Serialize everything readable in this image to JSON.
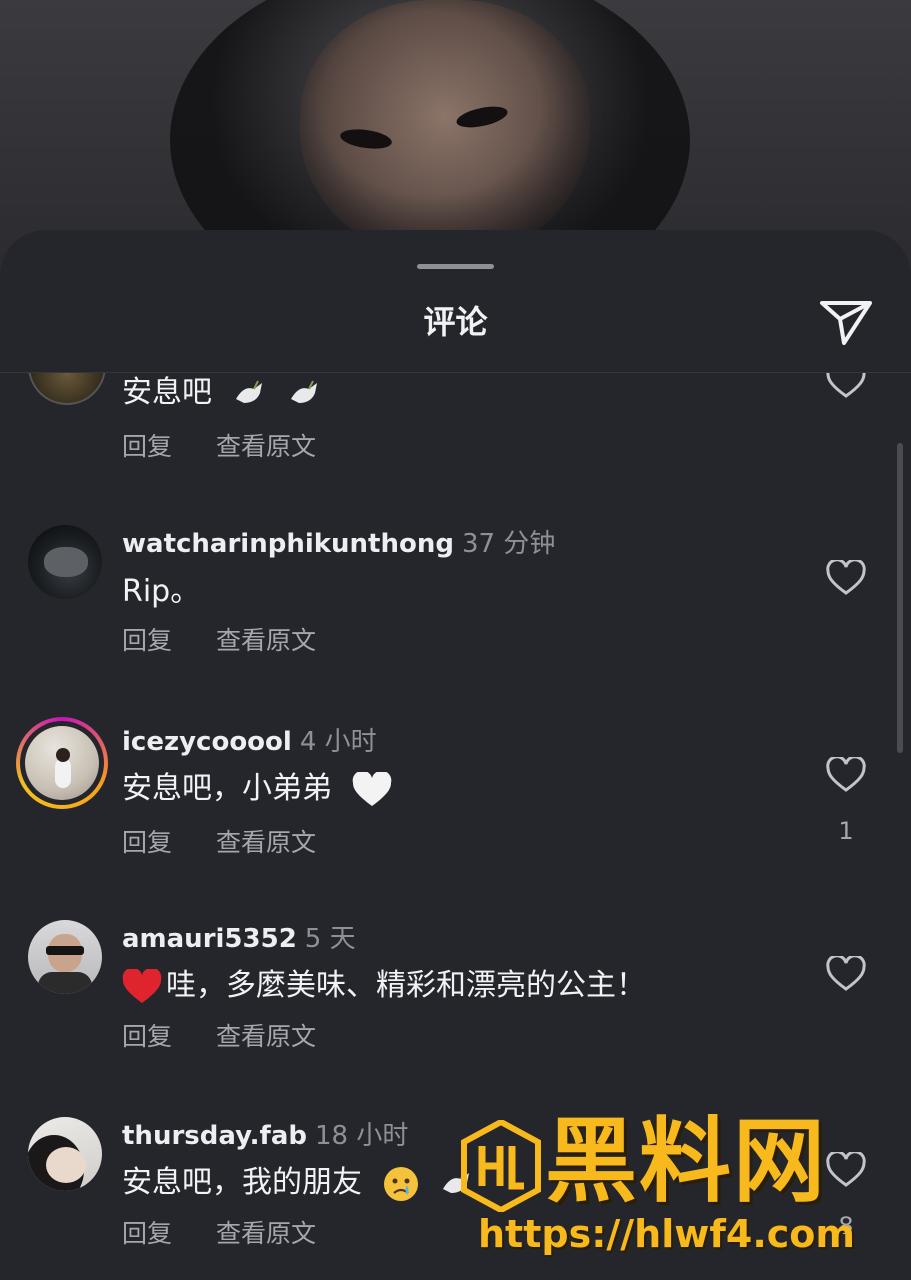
{
  "header": {
    "title": "评论"
  },
  "comments": [
    {
      "username": "",
      "time": "",
      "text": "安息吧",
      "doves": 2,
      "reply": "回复",
      "view_original": "查看原文",
      "likes": ""
    },
    {
      "username": "watcharinphikunthong",
      "time": "37 分钟",
      "text": "Rip。",
      "reply": "回复",
      "view_original": "查看原文",
      "likes": ""
    },
    {
      "username": "icezycooool",
      "time": "4 小时",
      "text": "安息吧，小弟弟",
      "reply": "回复",
      "view_original": "查看原文",
      "likes": "1"
    },
    {
      "username": "amauri5352",
      "time": "5 天",
      "text": "哇，多麼美味、精彩和漂亮的公主！",
      "reply": "回复",
      "view_original": "查看原文",
      "likes": ""
    },
    {
      "username": "thursday.fab",
      "time": "18 小时",
      "text": "安息吧，我的朋友",
      "reply": "回复",
      "view_original": "查看原文",
      "likes": "8"
    }
  ],
  "watermark": {
    "name": "黑料网",
    "url": "https://hlwf4.com"
  },
  "colors": {
    "sheet": "#24262b",
    "accent_watermark": "#f7b91c",
    "story_ring_start": "#c913b9",
    "story_ring_end": "#f8a11c"
  }
}
